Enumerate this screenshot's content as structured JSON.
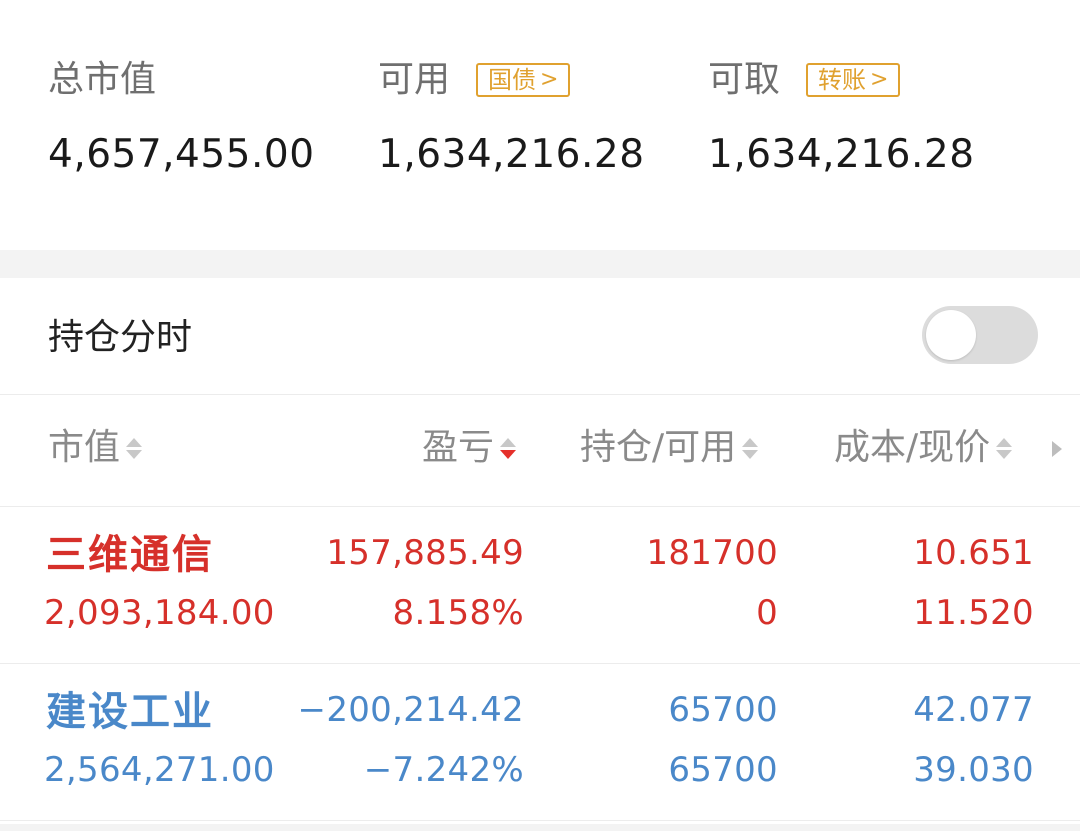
{
  "summary": {
    "total": {
      "label": "总市值",
      "value": "4,657,455.00"
    },
    "available": {
      "label": "可用",
      "value": "1,634,216.28",
      "tag": "国债"
    },
    "withdrawable": {
      "label": "可取",
      "value": "1,634,216.28",
      "tag": "转账"
    }
  },
  "toggle": {
    "label": "持仓分时",
    "enabled": false
  },
  "columns": [
    {
      "label": "市值",
      "sort": "none"
    },
    {
      "label": "盈亏",
      "sort": "desc"
    },
    {
      "label": "持仓/可用",
      "sort": "none"
    },
    {
      "label": "成本/现价",
      "sort": "none"
    }
  ],
  "holdings": [
    {
      "name": "三维通信",
      "market_value": "2,093,184.00",
      "pnl": "157,885.49",
      "pnl_pct": "8.158%",
      "position": "181700",
      "available": "0",
      "cost": "10.651",
      "price": "11.520",
      "color": "#d6302a"
    },
    {
      "name": "建设工业",
      "market_value": "2,564,271.00",
      "pnl": "−200,214.42",
      "pnl_pct": "−7.242%",
      "position": "65700",
      "available": "65700",
      "cost": "42.077",
      "price": "39.030",
      "color": "#4a88c9"
    }
  ],
  "icons": {
    "tag_arrow": "chevron-right-icon",
    "sort": "sort-icon",
    "more": "caret-right-icon"
  }
}
